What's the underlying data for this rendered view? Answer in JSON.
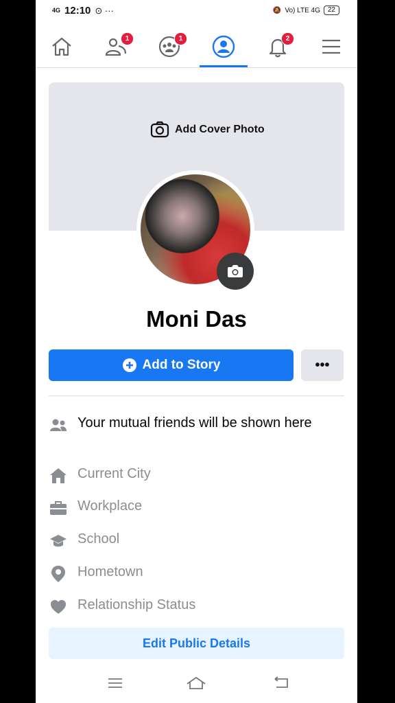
{
  "status_bar": {
    "signal": "4G",
    "time": "12:10",
    "extra": "⊙ ···",
    "network": "Vo) LTE 4G",
    "battery": "22"
  },
  "nav": {
    "friends_badge": "1",
    "groups_badge": "1",
    "notifications_badge": "2"
  },
  "cover": {
    "add_cover_label": "Add Cover Photo"
  },
  "profile": {
    "name": "Moni Das",
    "add_story_label": "Add to Story",
    "more_label": "•••"
  },
  "details": {
    "mutual_friends": "Your mutual friends will be shown here",
    "current_city": "Current City",
    "workplace": "Workplace",
    "school": "School",
    "hometown": "Hometown",
    "relationship": "Relationship Status"
  },
  "edit_public_details_label": "Edit Public Details",
  "colors": {
    "accent": "#1877f2",
    "badge": "#e41e3f",
    "light_accent": "#e7f3ff"
  }
}
